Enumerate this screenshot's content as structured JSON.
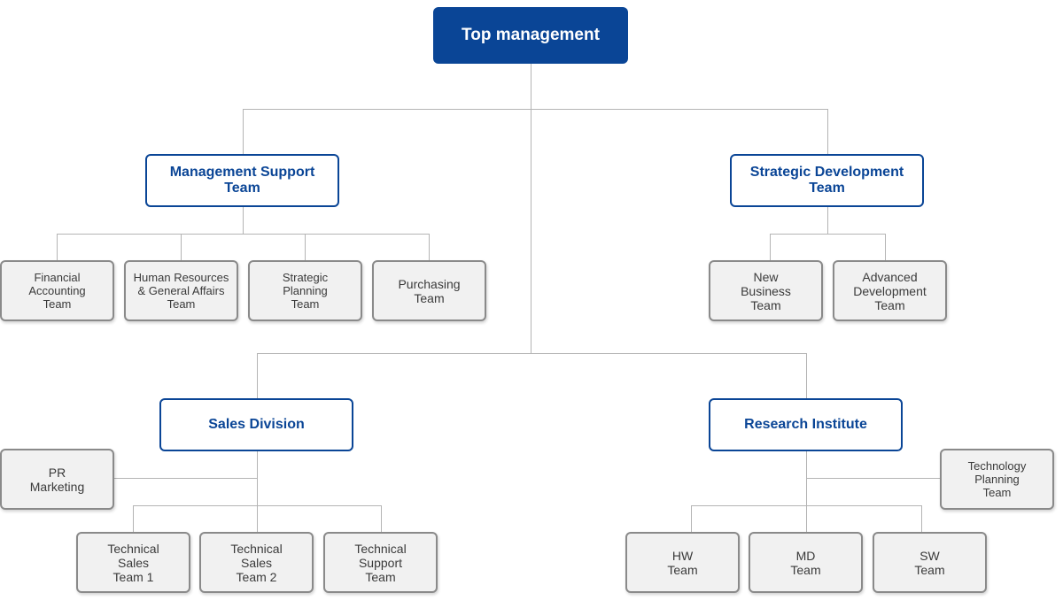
{
  "top": {
    "label": "Top management"
  },
  "departments": {
    "management_support": {
      "label": "Management Support\nTeam"
    },
    "strategic_development": {
      "label": "Strategic Development\nTeam"
    },
    "sales_division": {
      "label": "Sales Division"
    },
    "research_institute": {
      "label": "Research Institute"
    }
  },
  "teams": {
    "financial_accounting": "Financial\nAccounting\nTeam",
    "hr_general_affairs": "Human Resources\n& General Affairs\nTeam",
    "strategic_planning": "Strategic\nPlanning\nTeam",
    "purchasing": "Purchasing\nTeam",
    "new_business": "New\nBusiness\nTeam",
    "advanced_development": "Advanced\nDevelopment\nTeam",
    "pr_marketing": "PR\nMarketing",
    "technical_sales_1": "Technical\nSales\nTeam 1",
    "technical_sales_2": "Technical\nSales\nTeam 2",
    "technical_support": "Technical\nSupport\nTeam",
    "technology_planning": "Technology\nPlanning\nTeam",
    "hw": "HW\nTeam",
    "md": "MD\nTeam",
    "sw": "SW\nTeam"
  },
  "colors": {
    "primary": "#0a4596",
    "team_border": "#8a8a8a",
    "team_bg": "#f1f1f1",
    "connector": "#b4b4b4"
  }
}
